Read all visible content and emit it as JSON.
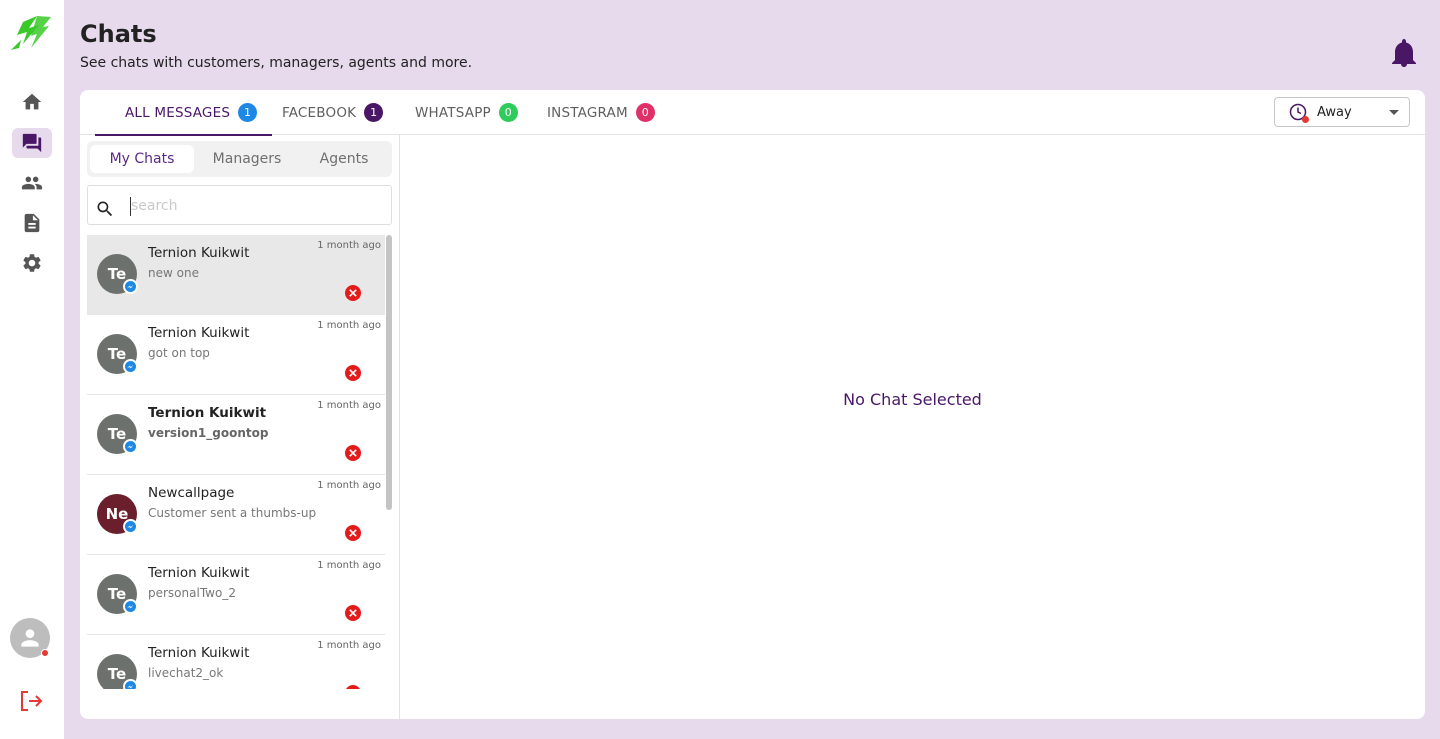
{
  "colors": {
    "page_bg": "#e6daec",
    "brand_purple": "#4a1766",
    "logo_green": "#39c928",
    "badge_blue": "#1e88e5",
    "badge_purple": "#4a1766",
    "badge_green": "#2ecc5b",
    "badge_pink": "#e0306a",
    "avatar_grey": "#6d716d",
    "avatar_maroon": "#6b1e2c",
    "close_red": "#e41b1b"
  },
  "sidebar": {
    "items": [
      {
        "name": "home",
        "icon": "home-icon"
      },
      {
        "name": "chats",
        "icon": "chat-icon",
        "active": true
      },
      {
        "name": "contacts",
        "icon": "people-icon"
      },
      {
        "name": "reports",
        "icon": "document-icon"
      },
      {
        "name": "settings",
        "icon": "gear-icon"
      }
    ],
    "logout_icon": "logout-icon"
  },
  "header": {
    "title": "Chats",
    "subtitle": "See chats with customers, managers, agents and more.",
    "bell_icon": "bell-icon"
  },
  "tabs": [
    {
      "label": "ALL MESSAGES",
      "count": "1",
      "active": true
    },
    {
      "label": "FACEBOOK",
      "count": "1"
    },
    {
      "label": "WHATSAPP",
      "count": "0"
    },
    {
      "label": "INSTAGRAM",
      "count": "0"
    }
  ],
  "status": {
    "value": "Away",
    "icon": "clock-icon"
  },
  "subtabs": [
    {
      "label": "My Chats",
      "active": true
    },
    {
      "label": "Managers"
    },
    {
      "label": "Agents"
    }
  ],
  "search": {
    "placeholder": "search",
    "value": ""
  },
  "chats": [
    {
      "initials": "Te",
      "name": "Ternion Kuikwit",
      "preview": "new one",
      "time": "1 month ago",
      "selected": true,
      "unread": false
    },
    {
      "initials": "Te",
      "name": "Ternion Kuikwit",
      "preview": "got on top",
      "time": "1 month ago",
      "selected": false,
      "unread": false
    },
    {
      "initials": "Te",
      "name": "Ternion Kuikwit",
      "preview": "version1_goontop",
      "time": "1 month ago",
      "selected": false,
      "unread": true
    },
    {
      "initials": "Ne",
      "name": "Newcallpage",
      "preview": "Customer sent a thumbs-up",
      "time": "1 month ago",
      "selected": false,
      "unread": false
    },
    {
      "initials": "Te",
      "name": "Ternion Kuikwit",
      "preview": "personalTwo_2",
      "time": "1 month ago",
      "selected": false,
      "unread": false
    },
    {
      "initials": "Te",
      "name": "Ternion Kuikwit",
      "preview": "livechat2_ok",
      "time": "1 month ago",
      "selected": false,
      "unread": false
    }
  ],
  "empty_state": "No Chat Selected"
}
